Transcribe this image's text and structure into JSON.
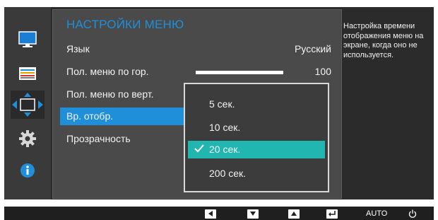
{
  "menu": {
    "title": "НАСТРОЙКИ МЕНЮ",
    "items": [
      {
        "label": "Язык",
        "value": "Русский"
      },
      {
        "label": "Пол. меню по гор.",
        "value": "100"
      },
      {
        "label": "Пол. меню по верт.",
        "value": ""
      },
      {
        "label": "Вр. отобр.",
        "value": ""
      },
      {
        "label": "Прозрачность",
        "value": ""
      }
    ]
  },
  "dropdown": {
    "options": [
      "5 сек.",
      "10 сек.",
      "20 сек.",
      "200 сек."
    ],
    "selected": "20 сек."
  },
  "help_text": "Настройка времени отображения меню на экране, когда оно не используется.",
  "bottom_bar": {
    "auto_label": "AUTO"
  },
  "sidebar_icons": [
    "monitor-icon",
    "color-bars-icon",
    "move-arrows-icon",
    "gear-icon",
    "info-icon"
  ],
  "colors": {
    "accent_blue": "#1e8fd8",
    "selected_option": "#22b6b0"
  }
}
